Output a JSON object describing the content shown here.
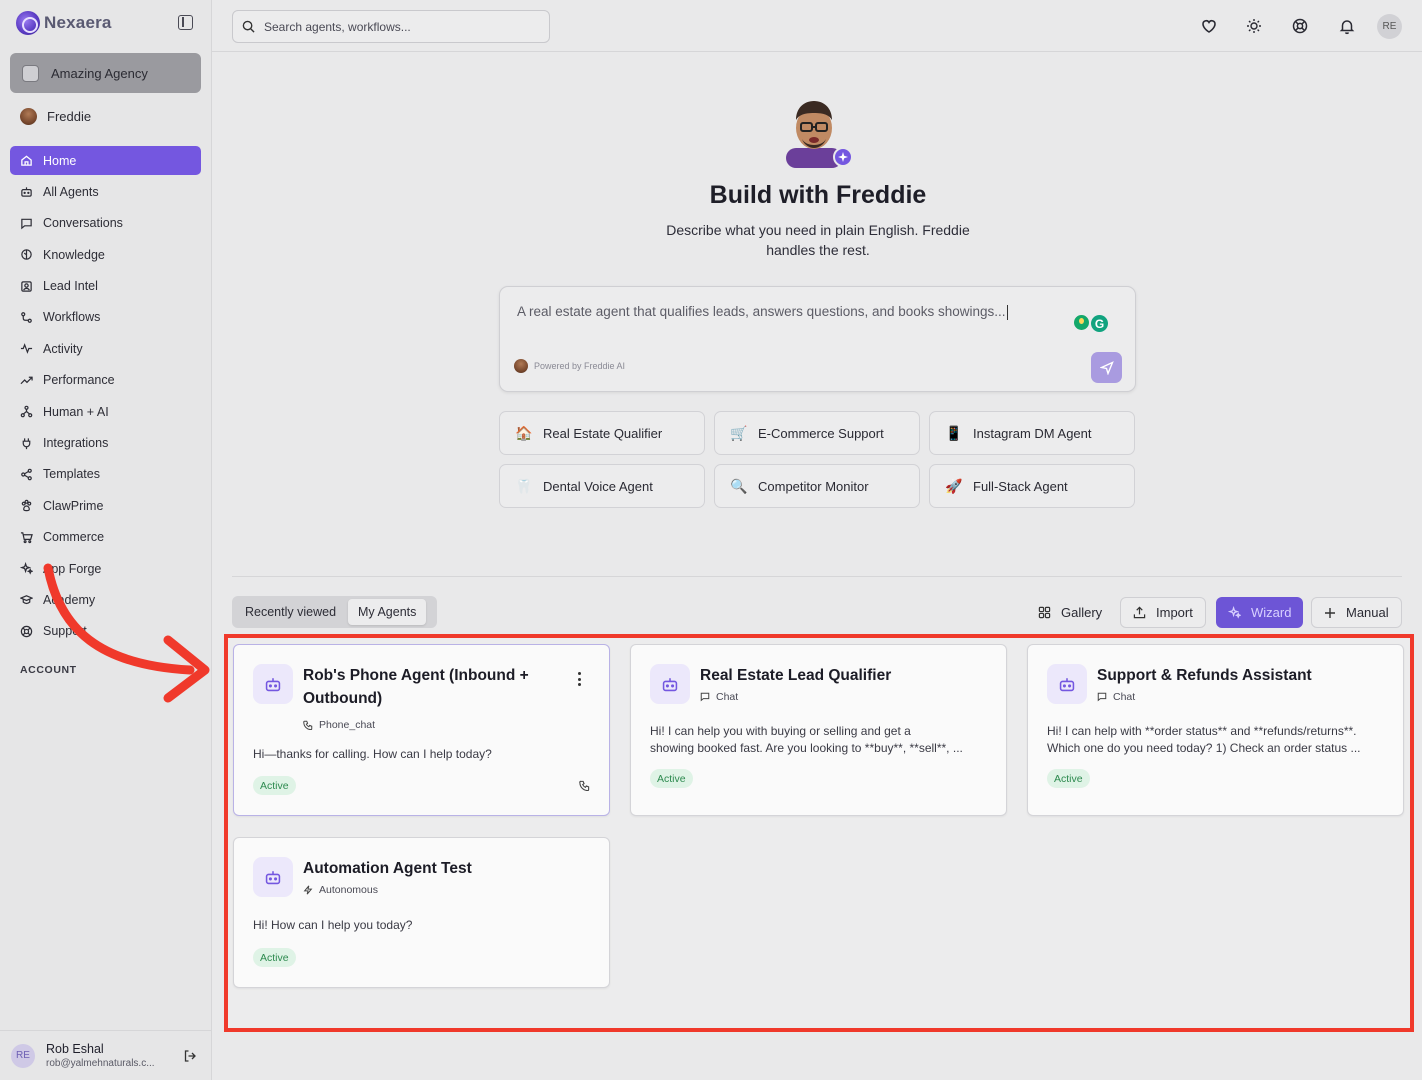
{
  "app": {
    "brand": "Nexaera"
  },
  "sidebar": {
    "agency": "Amazing Agency",
    "persona": "Freddie",
    "items": [
      {
        "label": "Home",
        "icon": "home-icon",
        "active": true
      },
      {
        "label": "All Agents",
        "icon": "bot-icon"
      },
      {
        "label": "Conversations",
        "icon": "message-square-icon"
      },
      {
        "label": "Knowledge",
        "icon": "brain-icon"
      },
      {
        "label": "Lead Intel",
        "icon": "contact-icon"
      },
      {
        "label": "Workflows",
        "icon": "workflow-icon"
      },
      {
        "label": "Activity",
        "icon": "activity-icon"
      },
      {
        "label": "Performance",
        "icon": "trending-up-icon"
      },
      {
        "label": "Human + AI",
        "icon": "network-icon"
      },
      {
        "label": "Integrations",
        "icon": "plug-icon"
      },
      {
        "label": "Templates",
        "icon": "share-icon"
      },
      {
        "label": "ClawPrime",
        "icon": "paw-icon"
      },
      {
        "label": "Commerce",
        "icon": "cart-icon"
      },
      {
        "label": "App Forge",
        "icon": "sparkles-icon"
      },
      {
        "label": "Academy",
        "icon": "graduation-cap-icon"
      },
      {
        "label": "Support",
        "icon": "lifebuoy-icon"
      }
    ],
    "account_label": "ACCOUNT",
    "user": {
      "initials": "RE",
      "name": "Rob Eshal",
      "email": "rob@yalmehnaturals.c..."
    }
  },
  "topbar": {
    "search_placeholder": "Search agents, workflows...",
    "icons": [
      "heart-icon",
      "sun-icon",
      "lifebuoy-icon",
      "bell-icon"
    ],
    "user_initials": "RE"
  },
  "hero": {
    "title": "Build with Freddie",
    "subtitle": "Describe what you need in plain English. Freddie handles the rest.",
    "prompt_text": "A real estate agent that qualifies leads, answers questions, and books showings...",
    "powered_by": "Powered by Freddie AI"
  },
  "chips": [
    {
      "label": "Real Estate Qualifier",
      "emoji": "🏠"
    },
    {
      "label": "E-Commerce Support",
      "emoji": "🛒"
    },
    {
      "label": "Instagram DM Agent",
      "emoji": "📱"
    },
    {
      "label": "Dental Voice Agent",
      "emoji": "🦷"
    },
    {
      "label": "Competitor Monitor",
      "emoji": "🔍"
    },
    {
      "label": "Full-Stack Agent",
      "emoji": "🚀"
    }
  ],
  "tabs": [
    {
      "label": "Recently viewed",
      "active": false
    },
    {
      "label": "My Agents",
      "active": true
    }
  ],
  "actions": {
    "gallery": "Gallery",
    "import": "Import",
    "wizard": "Wizard",
    "manual": "Manual"
  },
  "agents": [
    {
      "title_line1": "Rob's Phone Agent (Inbound +",
      "title_line2": "Outbound)",
      "type": "Phone_chat",
      "type_icon": "phone-icon",
      "desc_line1": "Hi—thanks for calling. How can I help today?",
      "desc_line2": "",
      "status": "Active"
    },
    {
      "title_line1": "Real Estate Lead Qualifier",
      "title_line2": "",
      "type": "Chat",
      "type_icon": "message-square-icon",
      "desc_line1": "Hi! I can help you with buying or selling and get a",
      "desc_line2": "showing booked fast. Are you looking to **buy**, **sell**, ...",
      "status": "Active"
    },
    {
      "title_line1": "Support & Refunds Assistant",
      "title_line2": "",
      "type": "Chat",
      "type_icon": "message-square-icon",
      "desc_line1": "Hi! I can help with **order status** and **refunds/returns**.",
      "desc_line2": "Which one do you need today? 1) Check an order status ...",
      "status": "Active"
    },
    {
      "title_line1": "Automation Agent Test",
      "title_line2": "",
      "type": "Autonomous",
      "type_icon": "zap-icon",
      "desc_line1": "Hi! How can I help you today?",
      "desc_line2": "",
      "status": "Active"
    }
  ],
  "colors": {
    "accent": "#7457e0",
    "highlight_border": "#f0392b",
    "active_badge_bg": "#dff3e6",
    "active_badge_text": "#2d8a4f"
  }
}
